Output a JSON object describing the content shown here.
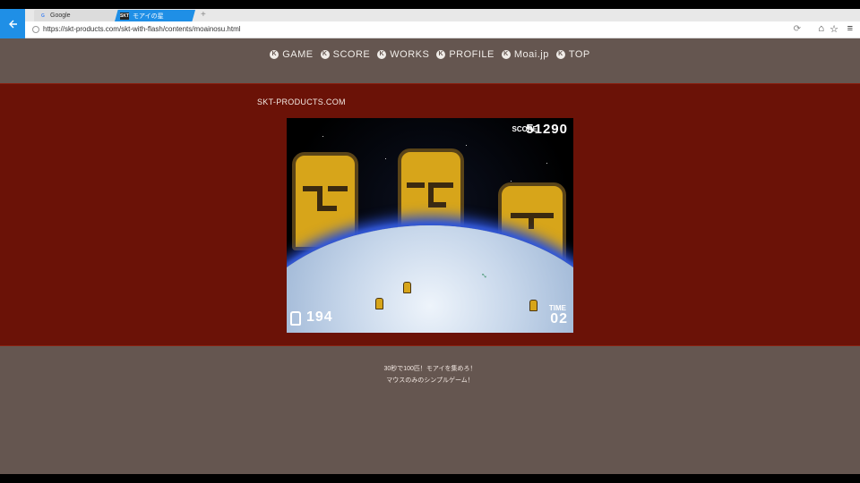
{
  "browser": {
    "tabs": [
      {
        "label": "Google",
        "icon": "google-g-icon"
      },
      {
        "label": "モアイの星",
        "icon": "skt-favicon-icon"
      }
    ],
    "favicon_skt_text": "SKT",
    "favicon_google_text": "G",
    "new_tab_glyph": "+",
    "url": "https://skt-products.com/skt-with-flash/contents/moainosu.html",
    "accent_color": "#1f8fe6"
  },
  "nav": {
    "items": [
      {
        "label": "GAME"
      },
      {
        "label": "SCORE"
      },
      {
        "label": "WORKS"
      },
      {
        "label": "PROFILE"
      },
      {
        "label": "Moai.jp"
      },
      {
        "label": "TOP"
      }
    ],
    "bullet_glyph": "K",
    "band_color": "#655650"
  },
  "site_label": "SKT-PRODUCTS.COM",
  "game": {
    "score_label": "SCORE",
    "score_value": "51290",
    "count_value": "194",
    "time_label": "TIME",
    "time_value": "02",
    "band_color": "#6b1207"
  },
  "description": {
    "line1": "30秒で100匹！モアイを集めろ！",
    "line2": "マウスのみのシンプルゲーム！"
  }
}
